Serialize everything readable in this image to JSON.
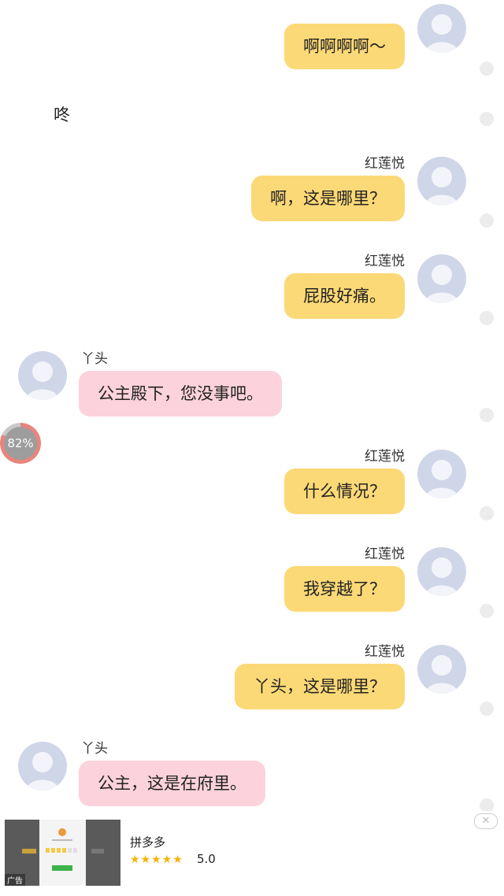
{
  "messages": [
    {
      "side": "right",
      "name": "",
      "text": "啊啊啊啊～"
    },
    {
      "side": "narration",
      "text": "咚"
    },
    {
      "side": "right",
      "name": "红莲悦",
      "text": "啊，这是哪里？"
    },
    {
      "side": "right",
      "name": "红莲悦",
      "text": "屁股好痛。"
    },
    {
      "side": "left",
      "name": "丫头",
      "text": "公主殿下，您没事吧。"
    },
    {
      "side": "right",
      "name": "红莲悦",
      "text": "什么情况？"
    },
    {
      "side": "right",
      "name": "红莲悦",
      "text": "我穿越了？"
    },
    {
      "side": "right",
      "name": "红莲悦",
      "text": "丫头，这是哪里？"
    },
    {
      "side": "left",
      "name": "丫头",
      "text": "公主，这是在府里。"
    }
  ],
  "progress": {
    "label": "82%",
    "value": 0.82
  },
  "ad": {
    "title": "拼多多",
    "rating": "5.0",
    "stars": "★★★★★",
    "badge": "广告",
    "close_icon": "close-icon"
  },
  "colors": {
    "user_bubble": "#fcd977",
    "other_bubble": "#fcd2dc",
    "avatar": "#cfd6e8"
  }
}
